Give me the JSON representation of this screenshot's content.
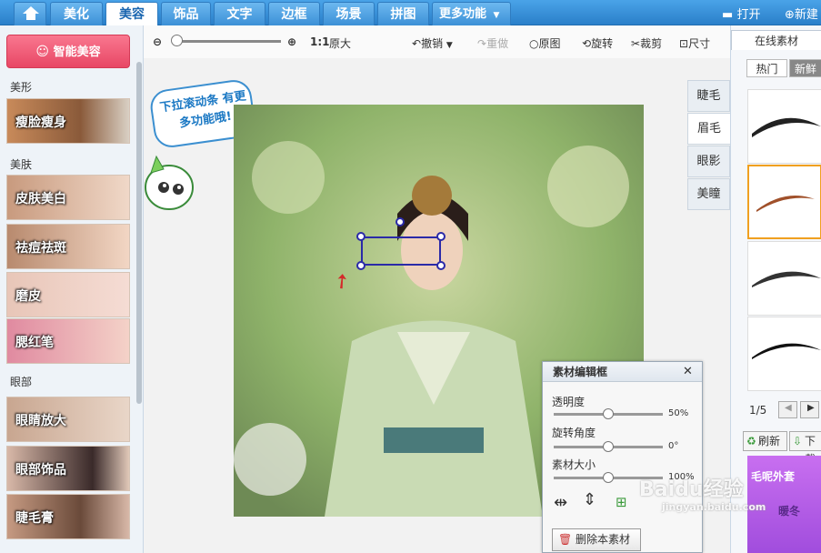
{
  "tabs": [
    "美化",
    "美容",
    "饰品",
    "文字",
    "边框",
    "场景",
    "拼图",
    "更多功能"
  ],
  "active_tab": "美容",
  "top_actions": {
    "open": "打开",
    "new": "新建"
  },
  "sidebar": {
    "smart_button": "智能美容",
    "sections": [
      {
        "title": "美形",
        "items": [
          "瘦脸瘦身"
        ]
      },
      {
        "title": "美肤",
        "items": [
          "皮肤美白",
          "祛痘祛斑",
          "磨皮",
          "腮红笔"
        ]
      },
      {
        "title": "眼部",
        "items": [
          "眼睛放大",
          "眼部饰品",
          "睫毛膏"
        ]
      }
    ]
  },
  "toolbar": {
    "zoom_label": "1:1",
    "zoom_text": "原大",
    "undo": "撤销",
    "redo": "重做",
    "original": "原图",
    "rotate": "旋转",
    "crop": "裁剪",
    "size": "尺寸"
  },
  "bubble_text": "下拉滚动条 有更多功能哦!",
  "side_tabs": [
    "睫毛",
    "眉毛",
    "眼影",
    "美瞳"
  ],
  "active_side_tab": "眉毛",
  "right_panel": {
    "tab": "在线素材",
    "subtabs": [
      "热门",
      "新鲜"
    ],
    "page": "1/5",
    "refresh": "刷新",
    "download": "下载",
    "ad_text": [
      "毛呢外套",
      "暖冬"
    ]
  },
  "editor": {
    "title": "素材编辑框",
    "opacity_label": "透明度",
    "opacity_value": "50%",
    "rotation_label": "旋转角度",
    "rotation_value": "0°",
    "size_label": "素材大小",
    "size_value": "100%",
    "delete": "删除本素材",
    "opacity": 0.5,
    "rotation": 0.5,
    "size": 0.5
  },
  "watermark": "Baidu经验 jingyan.baidu.com",
  "colors": {
    "topbar": "#2a7fc9",
    "smart": "#e84765",
    "selected": "#f0a020"
  }
}
